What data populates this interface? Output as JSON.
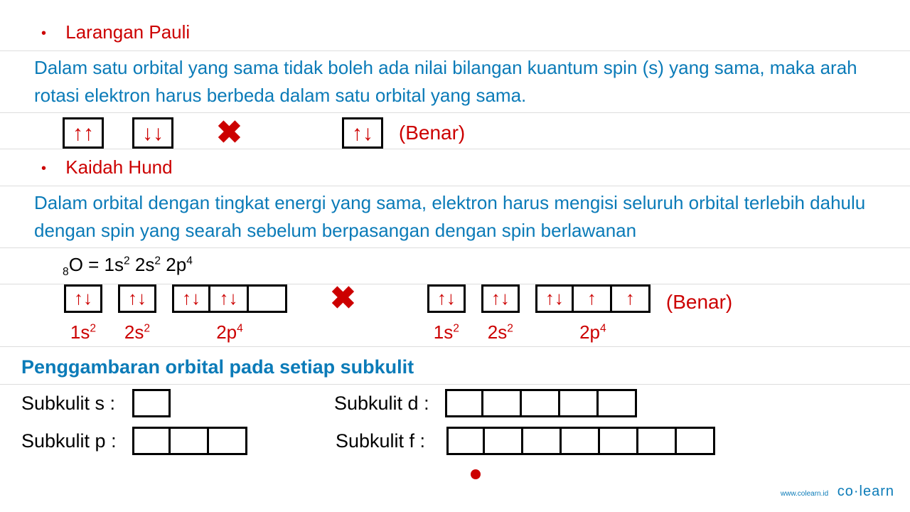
{
  "section1": {
    "title": "Larangan Pauli",
    "desc": "Dalam satu orbital yang sama tidak boleh ada nilai bilangan kuantum spin (s) yang sama, maka arah rotasi elektron harus berbeda dalam satu orbital yang sama.",
    "wrong1": "↑↑",
    "wrong2": "↓↓",
    "correct": "↑↓",
    "cross": "✖",
    "benar": "(Benar)"
  },
  "section2": {
    "title": "Kaidah Hund",
    "desc": "Dalam orbital dengan tingkat energi yang sama, elektron harus mengisi seluruh orbital terlebih dahulu dengan spin yang searah sebelum berpasangan dengan spin berlawanan",
    "formula_pre": "₈O = 1s",
    "formula": "O = 1s² 2s² 2p⁴",
    "wrong": {
      "b1": "↑↓",
      "b2": "↑↓",
      "p1": "↑↓",
      "p2": "↑↓",
      "p3": "",
      "l1": "1s²",
      "l2": "2s²",
      "l3": "2p⁴"
    },
    "correct": {
      "b1": "↑↓",
      "b2": "↑↓",
      "p1": "↑↓",
      "p2": "↑",
      "p3": "↑",
      "l1": "1s²",
      "l2": "2s²",
      "l3": "2p⁴"
    },
    "cross": "✖",
    "benar": "(Benar)"
  },
  "section3": {
    "title": "Penggambaran orbital pada setiap subkulit",
    "s": "Subkulit s :",
    "p": "Subkulit p :",
    "d": "Subkulit d :",
    "f": "Subkulit f  :"
  },
  "logo": {
    "url": "www.colearn.id",
    "brand": "co·learn"
  },
  "bullet": "•"
}
